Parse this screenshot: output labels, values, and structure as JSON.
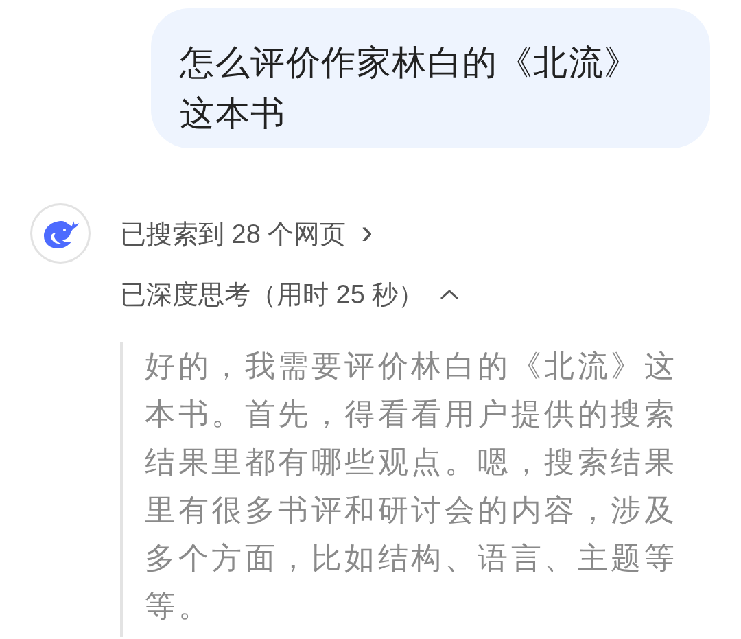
{
  "user_message": "怎么评价作家林白的《北流》这本书",
  "assistant": {
    "search_status": {
      "label": "已搜索到 28 个网页",
      "chevron": "›"
    },
    "thinking": {
      "label": "已深度思考（用时 25 秒）",
      "expanded": true,
      "text": "好的，我需要评价林白的《北流》这本书。首先，得看看用户提供的搜索结果里都有哪些观点。嗯，搜索结果里有很多书评和研讨会的内容，涉及多个方面，比如结构、语言、主题等等。"
    }
  }
}
